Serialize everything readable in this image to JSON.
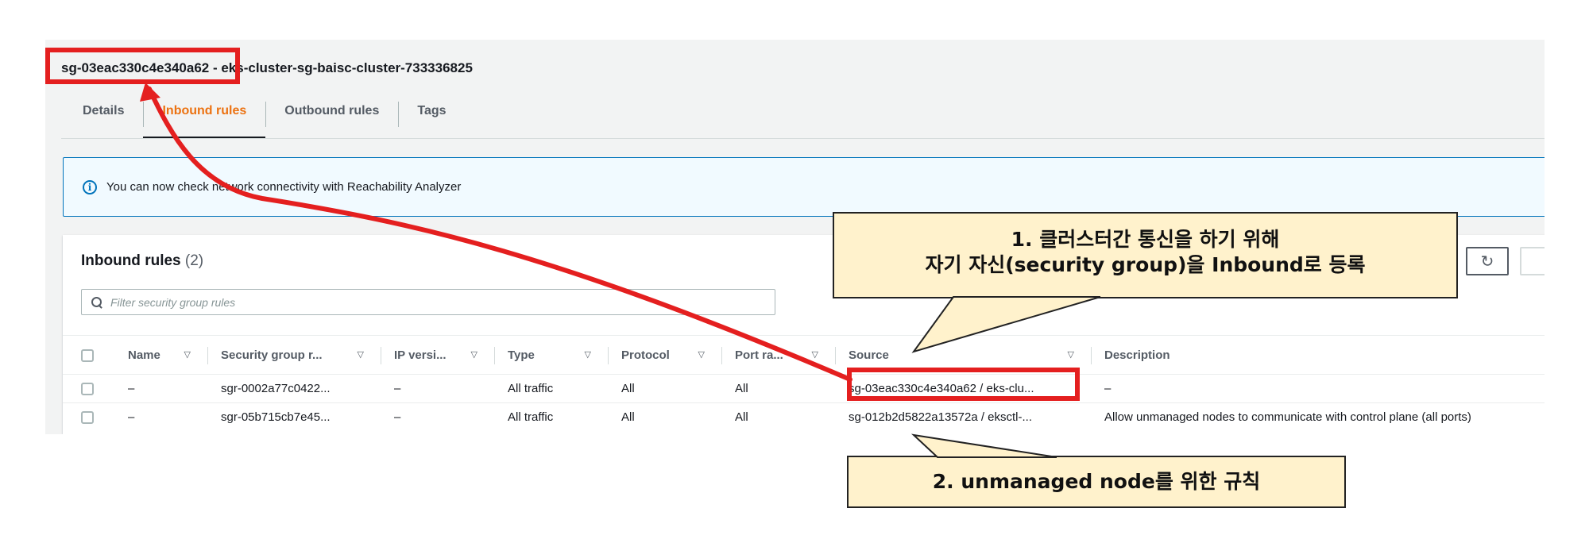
{
  "security_group": {
    "title": "sg-03eac330c4e340a62 - eks-cluster-sg-baisc-cluster-733336825"
  },
  "tabs": [
    {
      "label": "Details",
      "active": false
    },
    {
      "label": "Inbound rules",
      "active": true
    },
    {
      "label": "Outbound rules",
      "active": false
    },
    {
      "label": "Tags",
      "active": false
    }
  ],
  "info_banner": {
    "icon": "info-icon",
    "text": "You can now check network connectivity with Reachability Analyzer"
  },
  "inbound_panel": {
    "title": "Inbound rules",
    "count": "(2)",
    "refresh_icon": "refresh-icon",
    "search_placeholder": "Filter security group rules",
    "columns": [
      "Name",
      "Security group r...",
      "IP versi...",
      "Type",
      "Protocol",
      "Port ra...",
      "Source",
      "Description"
    ],
    "rows": [
      {
        "name": "–",
        "sg_rule": "sgr-0002a77c0422...",
        "ip_version": "–",
        "type": "All traffic",
        "protocol": "All",
        "port_range": "All",
        "source": "sg-03eac330c4e340a62 / eks-clu...",
        "description": "–"
      },
      {
        "name": "–",
        "sg_rule": "sgr-05b715cb7e45...",
        "ip_version": "–",
        "type": "All traffic",
        "protocol": "All",
        "port_range": "All",
        "source": "sg-012b2d5822a13572a / eksctl-...",
        "description": "Allow unmanaged nodes to communicate with control plane (all ports)"
      }
    ]
  },
  "annotations": {
    "callout_1_line1": "1. 클러스터간 통신을 하기 위해",
    "callout_1_line2": "자기 자신(security group)을 Inbound로 등록",
    "callout_2": "2. unmanaged node를 위한 규칙",
    "highlight_color": "#e41f1f",
    "callout_bg": "#fff2cc"
  }
}
